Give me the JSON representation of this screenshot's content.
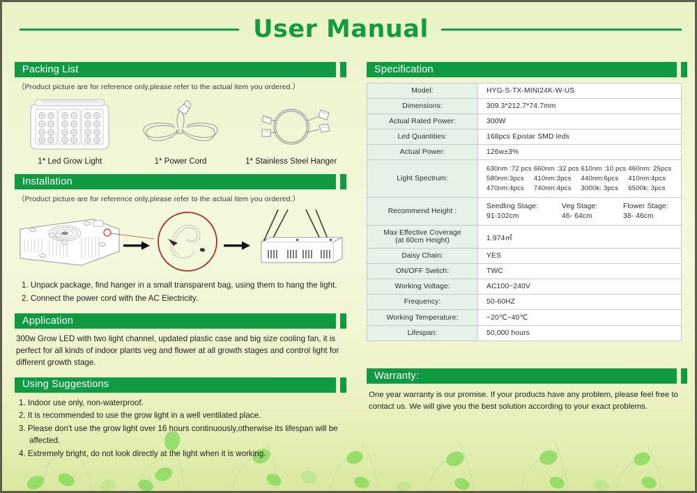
{
  "document": {
    "title": "User Manual"
  },
  "sections": {
    "packing_list": {
      "heading": "Packing List",
      "note": "（Product picture are for reference only,please refer to the actual item you ordered.）",
      "items": [
        {
          "label": "1* Led Grow Light",
          "icon": "led-panel-icon"
        },
        {
          "label": "1* Power Cord",
          "icon": "power-cord-icon"
        },
        {
          "label": "1*  Stainless Steel Hanger",
          "icon": "steel-hanger-icon"
        }
      ]
    },
    "installation": {
      "heading": "Installation",
      "note": "（Product picture are for reference only,please refer to the actual item you ordered.）",
      "steps": [
        "1. Unpack package, find hanger in a small transparent bag, using them to hang the light.",
        "2. Connect the power cord with the AC Electricity."
      ]
    },
    "application": {
      "heading": "Application",
      "text": "300w Grow LED with two light channel,  updated plastic case and big size cooling fan, it is perfect for all kinds of indoor plants veg and flower at all growth stages and control light for different growth stage."
    },
    "using_suggestions": {
      "heading": "Using Suggestions",
      "items": [
        "1. Indoor use only, non-waterproof.",
        "2. It is recommended to use the grow light in a well ventilated place.",
        "3. Please don't use the grow light over 16 hours continuously,otherwise its lifespan will be affected.",
        "4. Extremely bright, do not look directly at the light when it is working."
      ]
    },
    "specification": {
      "heading": "Specification",
      "rows": [
        {
          "key": "Model:",
          "value": "HYG-S-TX-MINI24K-W-US"
        },
        {
          "key": "Dimensions:",
          "value": "309.3*212.7*74.7mm"
        },
        {
          "key": "Actual Rated Power:",
          "value": "300W"
        },
        {
          "key": "Led Quantities:",
          "value": "168pcs Epistar SMD leds"
        },
        {
          "key": "Actual Power:",
          "value": "126w±3%"
        }
      ],
      "light_spectrum": {
        "key": "Light Spectrum:",
        "cells": [
          "630nm :72 pcs",
          "660nm :32 pcs",
          "610nm :10 pcs",
          "460nm: 25pcs",
          "580nm:3pcs",
          "410nm:3pcs",
          "440nm:6pcs",
          "410nm:4pcs",
          "470nm:4pcs",
          "740nm:4pcs",
          "3000k: 3pcs",
          "6500k: 3pcs"
        ]
      },
      "recommend_height": {
        "key": "Recommend Height :",
        "stages": [
          {
            "name": "Seedling Stage:",
            "range": "91-102cm"
          },
          {
            "name": "Veg Stage:",
            "range": "46- 64cm"
          },
          {
            "name": "Flower Stage:",
            "range": "38- 46cm"
          }
        ]
      },
      "rows_tail": [
        {
          "key": "Max Effective Coverage\n(at 60cm Height)",
          "key_line1": "Max Effective Coverage",
          "key_line2": "(at 60cm Height)",
          "value": "1.974㎡"
        },
        {
          "key": "Daisy Chain:",
          "value": "YES"
        },
        {
          "key": "ON/OFF Switch:",
          "value": "TWC"
        },
        {
          "key": "Working Voltage:",
          "value": "AC100~240V"
        },
        {
          "key": "Frequency:",
          "value": "50-60HZ"
        },
        {
          "key": "Working Temperature:",
          "value": "−20℃~40℃"
        },
        {
          "key": "Lifespan:",
          "value": "50,000 hours"
        }
      ]
    },
    "warranty": {
      "heading": "Warranty:",
      "text": "One year warranty is our promise. If your products have any problem, please feel free to contact us. We will give you the best solution according to your exact problems."
    }
  },
  "colors": {
    "brand_green": "#109b43",
    "title_green": "#149b3f",
    "table_key_bg": "#e6f2e6",
    "page_border": "#5d5d4c"
  }
}
